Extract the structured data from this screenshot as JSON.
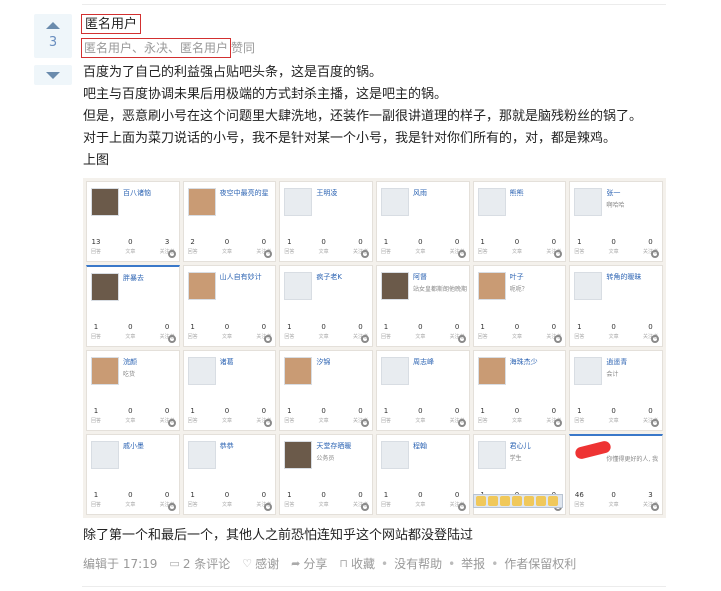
{
  "vote": {
    "count": "3"
  },
  "author": "匿名用户",
  "voters": {
    "names": "匿名用户、永决、匿名用户",
    "suffix": "赞同"
  },
  "paragraphs": [
    "百度为了自己的利益强占贴吧头条，这是百度的锅。",
    "吧主与百度协调未果后用极端的方式封杀主播，这是吧主的锅。",
    "但是，恶意刷小号在这个问题里大肆洗地，还装作一副很讲道理的样子，那就是脑残粉丝的锅了。",
    "对于上面为菜刀说话的小号，我不是针对某一个小号，我是针对你们所有的，对，都是辣鸡。",
    "上图"
  ],
  "screenshot_cards": [
    {
      "name": "百八诸恼",
      "sub": "",
      "stats": [
        "13",
        "0",
        "3"
      ],
      "avatar": "dark"
    },
    {
      "name": "夜空中最亮的星",
      "sub": "",
      "stats": [
        "2",
        "0",
        "0"
      ],
      "avatar": "photo"
    },
    {
      "name": "王明凌",
      "sub": "",
      "stats": [
        "1",
        "0",
        "0"
      ],
      "avatar": "blank"
    },
    {
      "name": "风雨",
      "sub": "",
      "stats": [
        "1",
        "0",
        "0"
      ],
      "avatar": "blank"
    },
    {
      "name": "熊熊",
      "sub": "",
      "stats": [
        "1",
        "0",
        "0"
      ],
      "avatar": "blank"
    },
    {
      "name": "张一",
      "sub": "啊哈哈",
      "stats": [
        "1",
        "0",
        "0"
      ],
      "avatar": "blank"
    },
    {
      "name": "胖暴去",
      "sub": "",
      "stats": [
        "1",
        "0",
        "0"
      ],
      "avatar": "dark"
    },
    {
      "name": "山人自有妙计",
      "sub": "",
      "stats": [
        "1",
        "0",
        "0"
      ],
      "avatar": "photo"
    },
    {
      "name": "疯子老K",
      "sub": "",
      "stats": [
        "1",
        "0",
        "0"
      ],
      "avatar": "blank"
    },
    {
      "name": "阿督",
      "sub": "站女皇都斯朗他晚期",
      "stats": [
        "1",
        "0",
        "0"
      ],
      "avatar": "dark"
    },
    {
      "name": "叶子",
      "sub": "呃呃？",
      "stats": [
        "1",
        "0",
        "0"
      ],
      "avatar": "photo"
    },
    {
      "name": "转角的暧昧",
      "sub": "",
      "stats": [
        "1",
        "0",
        "0"
      ],
      "avatar": "blank"
    },
    {
      "name": "浣颜",
      "sub": "吃货",
      "stats": [
        "1",
        "0",
        "0"
      ],
      "avatar": "photo"
    },
    {
      "name": "诸葛",
      "sub": "",
      "stats": [
        "1",
        "0",
        "0"
      ],
      "avatar": "blank"
    },
    {
      "name": "汐锦",
      "sub": "",
      "stats": [
        "1",
        "0",
        "0"
      ],
      "avatar": "photo"
    },
    {
      "name": "周志峰",
      "sub": "",
      "stats": [
        "1",
        "0",
        "0"
      ],
      "avatar": "blank"
    },
    {
      "name": "海珠杰少",
      "sub": "",
      "stats": [
        "1",
        "0",
        "0"
      ],
      "avatar": "photo"
    },
    {
      "name": "逍遥青",
      "sub": "会计",
      "stats": [
        "1",
        "0",
        "0"
      ],
      "avatar": "blank"
    },
    {
      "name": "戚小墨",
      "sub": "",
      "stats": [
        "1",
        "0",
        "0"
      ],
      "avatar": "blank"
    },
    {
      "name": "恭恭",
      "sub": "",
      "stats": [
        "1",
        "0",
        "0"
      ],
      "avatar": "blank"
    },
    {
      "name": "天堂存晒暖",
      "sub": "公务员",
      "stats": [
        "1",
        "0",
        "0"
      ],
      "avatar": "dark"
    },
    {
      "name": "程翰",
      "sub": "",
      "stats": [
        "1",
        "0",
        "0"
      ],
      "avatar": "blank"
    },
    {
      "name": "君心儿",
      "sub": "学生",
      "stats": [
        "1",
        "0",
        "0"
      ],
      "avatar": "blank"
    },
    {
      "name": "",
      "sub": "你懂得更好的人, 我",
      "stats": [
        "46",
        "0",
        "3"
      ],
      "avatar": "red"
    }
  ],
  "stat_labels": [
    "回答",
    "文章",
    "关注者"
  ],
  "after_image": "除了第一个和最后一个，其他人之前恐怕连知乎这个网站都没登陆过",
  "footer": {
    "edited": "编辑于 17:19",
    "comments": "2 条评论",
    "thanks": "感谢",
    "share": "分享",
    "collect": "收藏",
    "no_help": "没有帮助",
    "report": "举报",
    "copyright": "作者保留权利"
  }
}
